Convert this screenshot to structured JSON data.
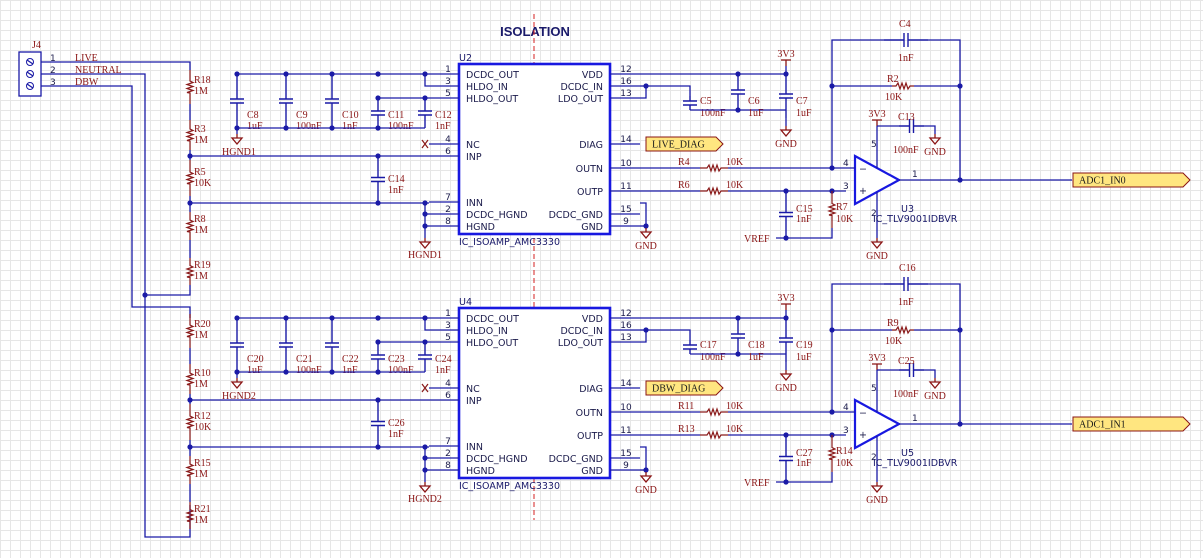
{
  "title": "ISOLATION",
  "connector": {
    "ref": "J4",
    "pins": [
      {
        "num": "1",
        "net": "LIVE"
      },
      {
        "num": "2",
        "net": "NEUTRAL"
      },
      {
        "num": "3",
        "net": "DBW"
      }
    ]
  },
  "iso_amps": [
    {
      "ref": "U2",
      "part": "IC_ISOAMP_AMC3330",
      "left_pins": [
        {
          "num": "1",
          "name": "DCDC_OUT"
        },
        {
          "num": "3",
          "name": "HLDO_IN"
        },
        {
          "num": "5",
          "name": "HLDO_OUT"
        },
        {
          "num": "4",
          "name": "NC"
        },
        {
          "num": "6",
          "name": "INP"
        },
        {
          "num": "7",
          "name": "INN"
        },
        {
          "num": "2",
          "name": "DCDC_HGND"
        },
        {
          "num": "8",
          "name": "HGND"
        }
      ],
      "right_pins": [
        {
          "num": "12",
          "name": "VDD"
        },
        {
          "num": "16",
          "name": "DCDC_IN"
        },
        {
          "num": "13",
          "name": "LDO_OUT"
        },
        {
          "num": "14",
          "name": "DIAG"
        },
        {
          "num": "10",
          "name": "OUTN"
        },
        {
          "num": "11",
          "name": "OUTP"
        },
        {
          "num": "15",
          "name": "DCDC_GND"
        },
        {
          "num": "9",
          "name": "GND"
        }
      ],
      "diag_net": "LIVE_DIAG",
      "hgnd": "HGND1"
    },
    {
      "ref": "U4",
      "part": "IC_ISOAMP_AMC3330",
      "left_pins": [
        {
          "num": "1",
          "name": "DCDC_OUT"
        },
        {
          "num": "3",
          "name": "HLDO_IN"
        },
        {
          "num": "5",
          "name": "HLDO_OUT"
        },
        {
          "num": "4",
          "name": "NC"
        },
        {
          "num": "6",
          "name": "INP"
        },
        {
          "num": "7",
          "name": "INN"
        },
        {
          "num": "2",
          "name": "DCDC_HGND"
        },
        {
          "num": "8",
          "name": "HGND"
        }
      ],
      "right_pins": [
        {
          "num": "12",
          "name": "VDD"
        },
        {
          "num": "16",
          "name": "DCDC_IN"
        },
        {
          "num": "13",
          "name": "LDO_OUT"
        },
        {
          "num": "14",
          "name": "DIAG"
        },
        {
          "num": "10",
          "name": "OUTN"
        },
        {
          "num": "11",
          "name": "OUTP"
        },
        {
          "num": "15",
          "name": "DCDC_GND"
        },
        {
          "num": "9",
          "name": "GND"
        }
      ],
      "diag_net": "DBW_DIAG",
      "hgnd": "HGND2"
    }
  ],
  "opamps": [
    {
      "ref": "U3",
      "part": "IC_TLV9001IDBVR",
      "out_net": "ADC1_IN0",
      "pins": {
        "inn": "4",
        "inp": "3",
        "vcc": "5",
        "gnd": "2",
        "out": "1"
      }
    },
    {
      "ref": "U5",
      "part": "IC_TLV9001IDBVR",
      "out_net": "ADC1_IN1",
      "pins": {
        "inn": "4",
        "inp": "3",
        "vcc": "5",
        "gnd": "2",
        "out": "1"
      }
    }
  ],
  "power": {
    "v3": "3V3",
    "gnd": "GND",
    "vref": "VREF"
  },
  "resistors": {
    "R18": "1M",
    "R3": "1M",
    "R5": "10K",
    "R8": "1M",
    "R19": "1M",
    "R20": "1M",
    "R10": "1M",
    "R12": "10K",
    "R15": "1M",
    "R21": "1M",
    "R2": "10K",
    "R4": "10K",
    "R6": "10K",
    "R7": "10K",
    "R9": "10K",
    "R11": "10K",
    "R13": "10K",
    "R14": "10K"
  },
  "capacitors": {
    "C8": "1uF",
    "C9": "100nF",
    "C10": "1nF",
    "C11": "100nF",
    "C12": "1nF",
    "C14": "1nF",
    "C5": "100nF",
    "C6": "1uF",
    "C7": "1uF",
    "C4": "1nF",
    "C13": "100nF",
    "C15": "1nF",
    "C20": "1uF",
    "C21": "100nF",
    "C22": "1nF",
    "C23": "100nF",
    "C24": "1nF",
    "C26": "1nF",
    "C17": "100nF",
    "C18": "1uF",
    "C19": "1uF",
    "C16": "1nF",
    "C25": "100nF",
    "C27": "1nF"
  },
  "colors": {
    "wire": "#1a1aa6",
    "ic_border": "#1818e0",
    "ref_text": "#8a1414",
    "net_flag": "#ffe680",
    "isolation_line": "#d42020"
  }
}
